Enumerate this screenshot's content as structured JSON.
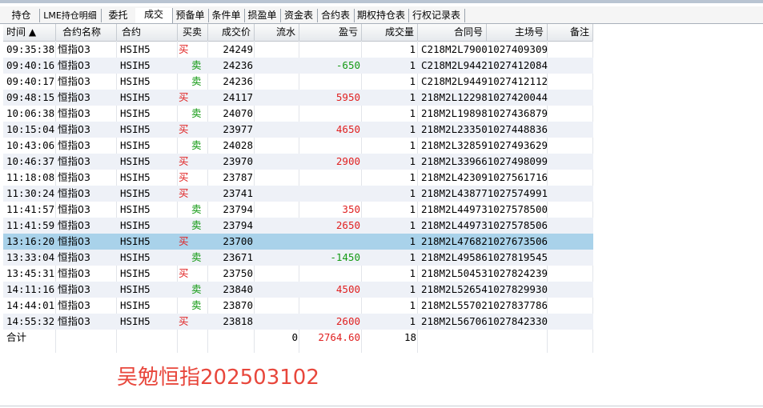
{
  "tabs": [
    {
      "label": "持仓"
    },
    {
      "label": "LME持仓明细"
    },
    {
      "label": "委托"
    },
    {
      "label": "成交",
      "active": true
    },
    {
      "label": "预备单"
    },
    {
      "label": "条件单"
    },
    {
      "label": "损盈单"
    },
    {
      "label": "资金表"
    },
    {
      "label": "合约表"
    },
    {
      "label": "期权持仓表"
    },
    {
      "label": "行权记录表"
    }
  ],
  "columns": [
    "时间 ▲",
    "合约名称",
    "合约",
    "买卖",
    "成交价",
    "流水",
    "盈亏",
    "成交量",
    "合同号",
    "主场号",
    "备注"
  ],
  "rows": [
    {
      "time": "09:35:38",
      "name": "恒指03",
      "code": "HSIH5",
      "side": "买",
      "side_type": "buy",
      "price": "24249",
      "flow": "",
      "pnl": "",
      "pnl_type": "",
      "qty": "1",
      "contract": "C218M2L79001027409309",
      "selected": false
    },
    {
      "time": "09:40:16",
      "name": "恒指03",
      "code": "HSIH5",
      "side": "卖",
      "side_type": "sell",
      "price": "24236",
      "flow": "",
      "pnl": "-650",
      "pnl_type": "neg",
      "qty": "1",
      "contract": "C218M2L94421027412084",
      "selected": false
    },
    {
      "time": "09:40:17",
      "name": "恒指03",
      "code": "HSIH5",
      "side": "卖",
      "side_type": "sell",
      "price": "24236",
      "flow": "",
      "pnl": "",
      "pnl_type": "",
      "qty": "1",
      "contract": "C218M2L94491027412112",
      "selected": false
    },
    {
      "time": "09:48:15",
      "name": "恒指03",
      "code": "HSIH5",
      "side": "买",
      "side_type": "buy",
      "price": "24117",
      "flow": "",
      "pnl": "5950",
      "pnl_type": "pos",
      "qty": "1",
      "contract": "218M2L122981027420044",
      "selected": false
    },
    {
      "time": "10:06:38",
      "name": "恒指03",
      "code": "HSIH5",
      "side": "卖",
      "side_type": "sell",
      "price": "24070",
      "flow": "",
      "pnl": "",
      "pnl_type": "",
      "qty": "1",
      "contract": "218M2L198981027436879",
      "selected": false
    },
    {
      "time": "10:15:04",
      "name": "恒指03",
      "code": "HSIH5",
      "side": "买",
      "side_type": "buy",
      "price": "23977",
      "flow": "",
      "pnl": "4650",
      "pnl_type": "pos",
      "qty": "1",
      "contract": "218M2L233501027448836",
      "selected": false
    },
    {
      "time": "10:43:06",
      "name": "恒指03",
      "code": "HSIH5",
      "side": "卖",
      "side_type": "sell",
      "price": "24028",
      "flow": "",
      "pnl": "",
      "pnl_type": "",
      "qty": "1",
      "contract": "218M2L328591027493629",
      "selected": false
    },
    {
      "time": "10:46:37",
      "name": "恒指03",
      "code": "HSIH5",
      "side": "买",
      "side_type": "buy",
      "price": "23970",
      "flow": "",
      "pnl": "2900",
      "pnl_type": "pos",
      "qty": "1",
      "contract": "218M2L339661027498099",
      "selected": false
    },
    {
      "time": "11:18:08",
      "name": "恒指03",
      "code": "HSIH5",
      "side": "买",
      "side_type": "buy",
      "price": "23787",
      "flow": "",
      "pnl": "",
      "pnl_type": "",
      "qty": "1",
      "contract": "218M2L423091027561716",
      "selected": false
    },
    {
      "time": "11:30:24",
      "name": "恒指03",
      "code": "HSIH5",
      "side": "买",
      "side_type": "buy",
      "price": "23741",
      "flow": "",
      "pnl": "",
      "pnl_type": "",
      "qty": "1",
      "contract": "218M2L438771027574991",
      "selected": false
    },
    {
      "time": "11:41:57",
      "name": "恒指03",
      "code": "HSIH5",
      "side": "卖",
      "side_type": "sell",
      "price": "23794",
      "flow": "",
      "pnl": "350",
      "pnl_type": "pos",
      "qty": "1",
      "contract": "218M2L449731027578500",
      "selected": false
    },
    {
      "time": "11:41:59",
      "name": "恒指03",
      "code": "HSIH5",
      "side": "卖",
      "side_type": "sell",
      "price": "23794",
      "flow": "",
      "pnl": "2650",
      "pnl_type": "pos",
      "qty": "1",
      "contract": "218M2L449731027578506",
      "selected": false
    },
    {
      "time": "13:16:20",
      "name": "恒指03",
      "code": "HSIH5",
      "side": "买",
      "side_type": "buy",
      "price": "23700",
      "flow": "",
      "pnl": "",
      "pnl_type": "",
      "qty": "1",
      "contract": "218M2L476821027673506",
      "selected": true
    },
    {
      "time": "13:33:04",
      "name": "恒指03",
      "code": "HSIH5",
      "side": "卖",
      "side_type": "sell",
      "price": "23671",
      "flow": "",
      "pnl": "-1450",
      "pnl_type": "neg",
      "qty": "1",
      "contract": "218M2L495861027819545",
      "selected": false
    },
    {
      "time": "13:45:31",
      "name": "恒指03",
      "code": "HSIH5",
      "side": "买",
      "side_type": "buy",
      "price": "23750",
      "flow": "",
      "pnl": "",
      "pnl_type": "",
      "qty": "1",
      "contract": "218M2L504531027824239",
      "selected": false
    },
    {
      "time": "14:11:16",
      "name": "恒指03",
      "code": "HSIH5",
      "side": "卖",
      "side_type": "sell",
      "price": "23840",
      "flow": "",
      "pnl": "4500",
      "pnl_type": "pos",
      "qty": "1",
      "contract": "218M2L526541027829930",
      "selected": false
    },
    {
      "time": "14:44:01",
      "name": "恒指03",
      "code": "HSIH5",
      "side": "卖",
      "side_type": "sell",
      "price": "23870",
      "flow": "",
      "pnl": "",
      "pnl_type": "",
      "qty": "1",
      "contract": "218M2L557021027837786",
      "selected": false
    },
    {
      "time": "14:55:32",
      "name": "恒指03",
      "code": "HSIH5",
      "side": "买",
      "side_type": "buy",
      "price": "23818",
      "flow": "",
      "pnl": "2600",
      "pnl_type": "pos",
      "qty": "1",
      "contract": "218M2L567061027842330",
      "selected": false
    }
  ],
  "total": {
    "label": "合计",
    "flow": "0",
    "pnl": "2764.60",
    "qty": "18"
  },
  "watermark": "吴勉恒指202503102",
  "colors": {
    "buy": "#e02020",
    "sell": "#149a14",
    "selected_row": "#a9d2ea",
    "alt_row": "#eef1f7",
    "watermark": "#e8473c"
  }
}
